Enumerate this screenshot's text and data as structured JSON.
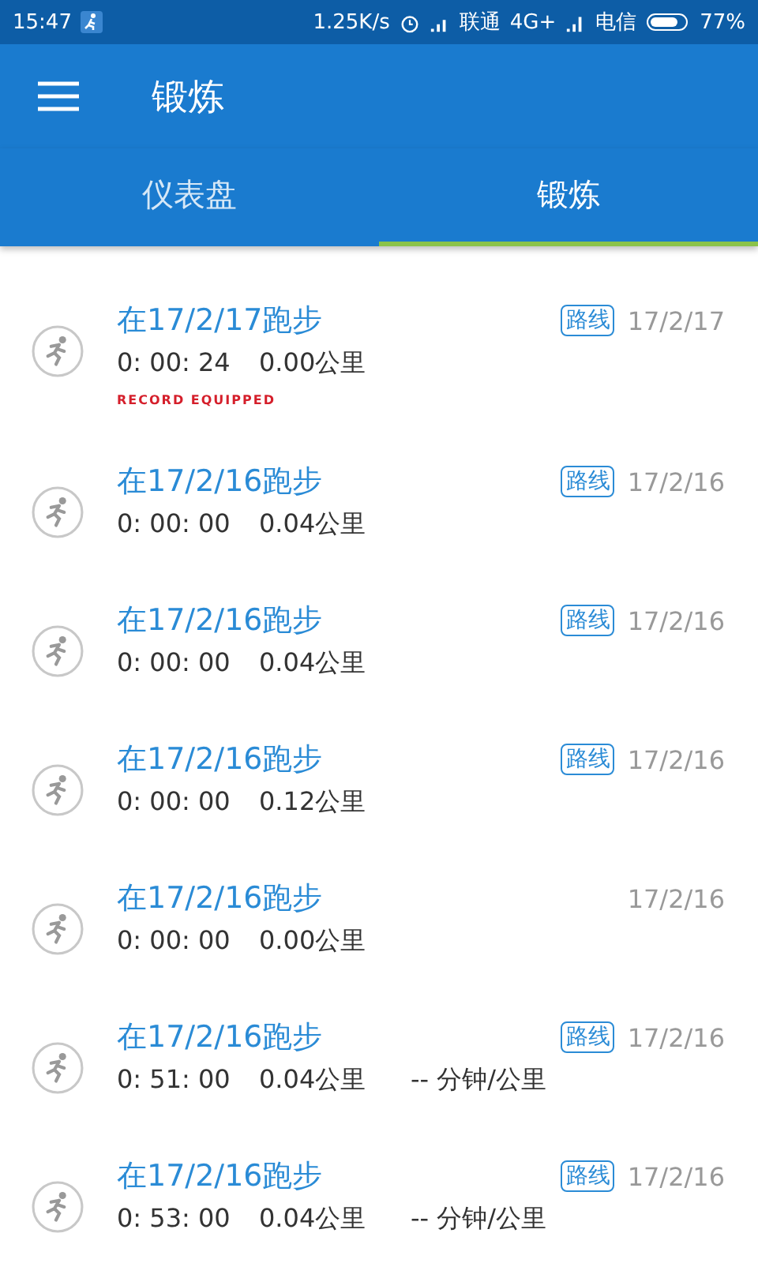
{
  "status_bar": {
    "time": "15:47",
    "speed": "1.25K/s",
    "carrier_1": "联通",
    "network": "4G+",
    "carrier_2": "电信",
    "battery": "77%"
  },
  "app_bar": {
    "title": "锻炼"
  },
  "tabs": [
    {
      "label": "仪表盘",
      "selected": false
    },
    {
      "label": "锻炼",
      "selected": true
    }
  ],
  "workouts": [
    {
      "title": "在17/2/17跑步",
      "duration": "0: 00: 24",
      "distance": "0.00公里",
      "route": "路线",
      "date": "17/2/17",
      "brand": "RECORD EQUIPPED"
    },
    {
      "title": "在17/2/16跑步",
      "duration": "0: 00: 00",
      "distance": "0.04公里",
      "route": "路线",
      "date": "17/2/16"
    },
    {
      "title": "在17/2/16跑步",
      "duration": "0: 00: 00",
      "distance": "0.04公里",
      "route": "路线",
      "date": "17/2/16"
    },
    {
      "title": "在17/2/16跑步",
      "duration": "0: 00: 00",
      "distance": "0.12公里",
      "route": "路线",
      "date": "17/2/16"
    },
    {
      "title": "在17/2/16跑步",
      "duration": "0: 00: 00",
      "distance": "0.00公里",
      "date": "17/2/16"
    },
    {
      "title": "在17/2/16跑步",
      "duration": "0: 51: 00",
      "distance": "0.04公里",
      "pace": "-- 分钟/公里",
      "route": "路线",
      "date": "17/2/16"
    },
    {
      "title": "在17/2/16跑步",
      "duration": "0: 53: 00",
      "distance": "0.04公里",
      "pace": "-- 分钟/公里",
      "route": "路线",
      "date": "17/2/16"
    }
  ]
}
